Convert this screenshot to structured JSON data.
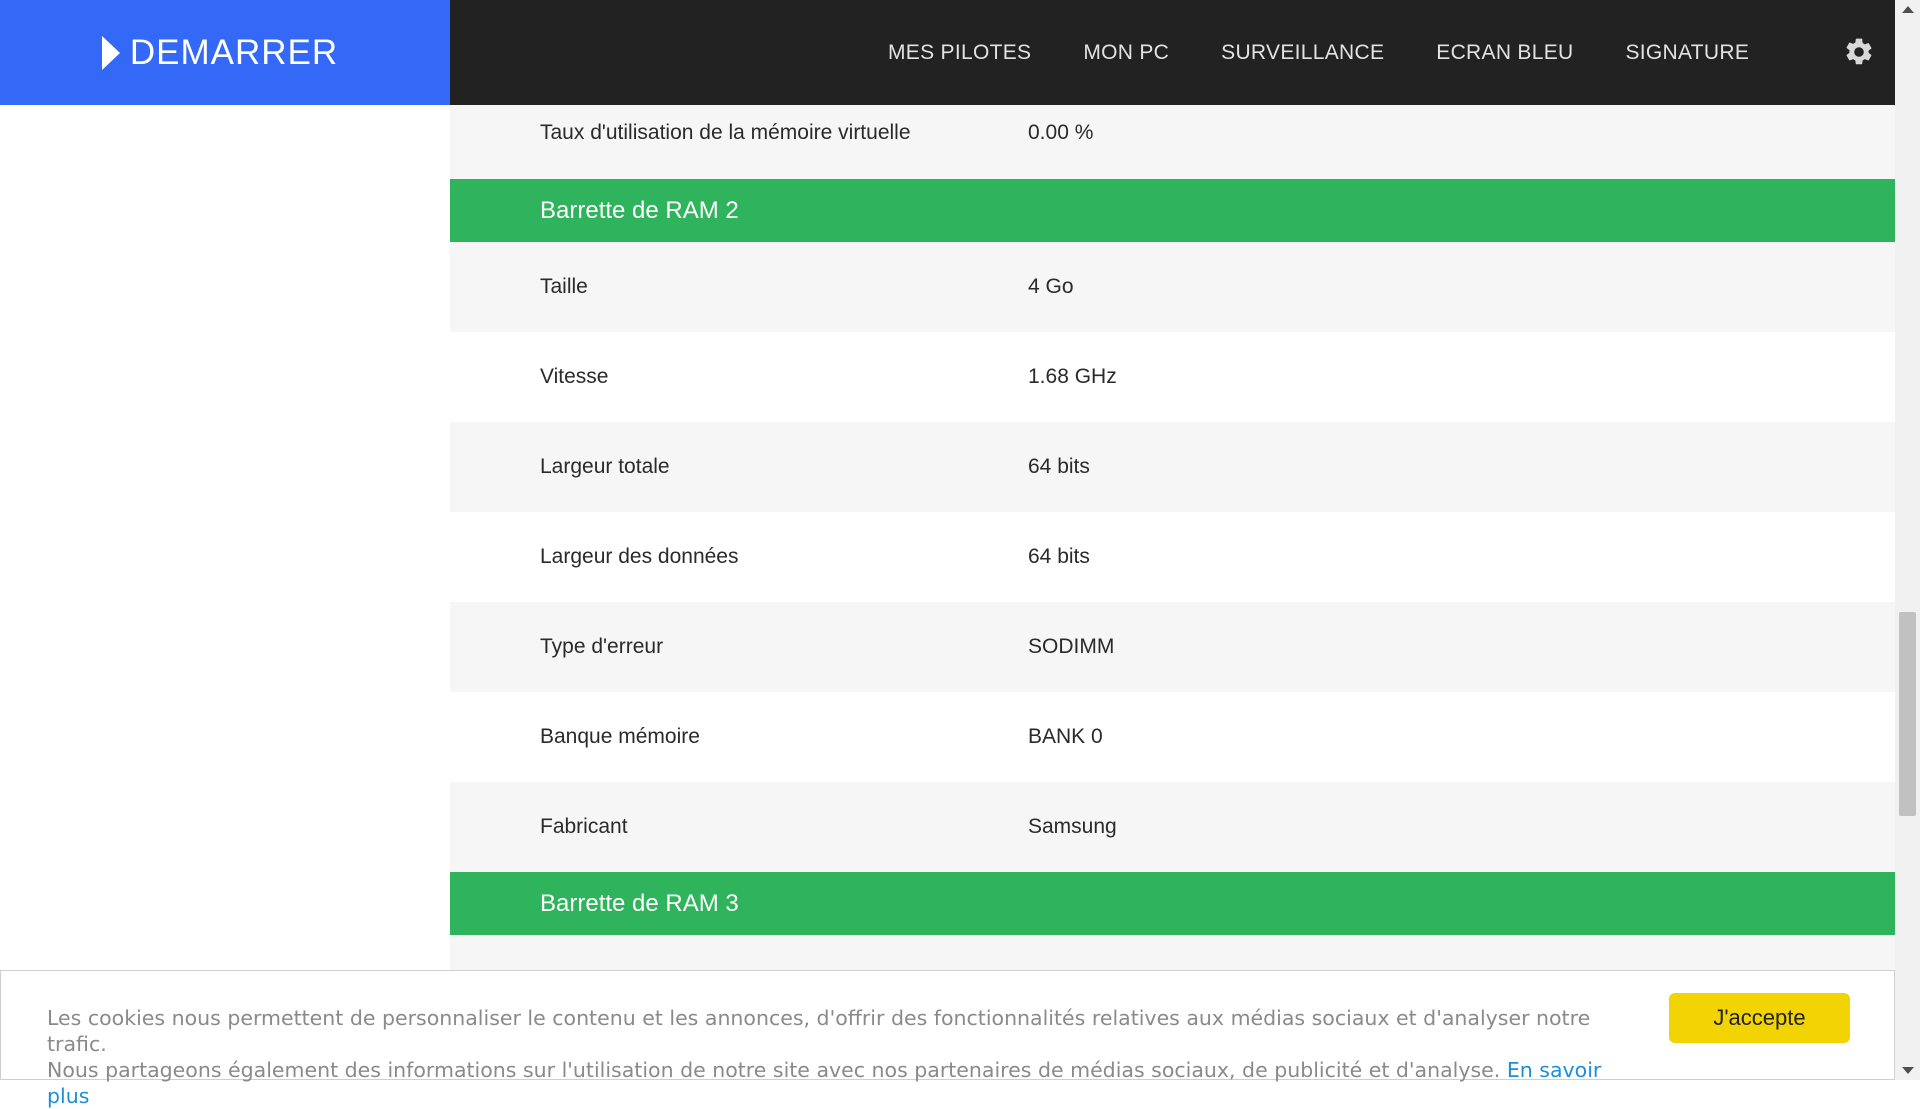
{
  "header": {
    "brand_label": "DEMARRER",
    "nav": [
      "MES PILOTES",
      "MON PC",
      "SURVEILLANCE",
      "ECRAN BLEU",
      "SIGNATURE"
    ],
    "settings_icon": "gear-icon"
  },
  "content": {
    "top_row": {
      "label": "Taux d'utilisation de la mémoire virtuelle",
      "value": "0.00 %"
    },
    "section_ram2": {
      "title": "Barrette de RAM 2",
      "rows": [
        {
          "label": "Taille",
          "value": "4 Go"
        },
        {
          "label": "Vitesse",
          "value": "1.68 GHz"
        },
        {
          "label": "Largeur totale",
          "value": "64 bits"
        },
        {
          "label": "Largeur des données",
          "value": "64 bits"
        },
        {
          "label": "Type d'erreur",
          "value": "SODIMM"
        },
        {
          "label": "Banque mémoire",
          "value": "BANK 0"
        },
        {
          "label": "Fabricant",
          "value": "Samsung"
        }
      ]
    },
    "section_ram3": {
      "title": "Barrette de RAM 3"
    }
  },
  "cookie": {
    "line1": "Les cookies nous permettent de personnaliser le contenu et les annonces, d'offrir des fonctionnalités relatives aux médias sociaux et d'analyser notre trafic.",
    "line2": "Nous partageons également des informations sur l'utilisation de notre site avec nos partenaires de médias sociaux, de publicité et d'analyse.",
    "link": "En savoir plus",
    "accept": "J'accepte"
  },
  "colors": {
    "brand": "#3369f6",
    "header_bg": "#222222",
    "section_bg": "#2fb35c",
    "accept_bg": "#f2d304",
    "link": "#1e8ed6"
  }
}
